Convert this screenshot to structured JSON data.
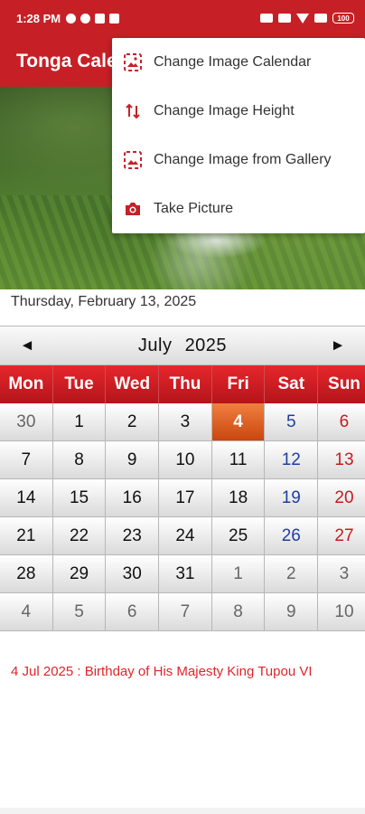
{
  "status_bar": {
    "time": "1:28 PM",
    "battery": "100"
  },
  "app_bar": {
    "title": "Tonga Calendar"
  },
  "menu": {
    "items": [
      {
        "label": "Change Image Calendar",
        "icon": "image-calendar-icon"
      },
      {
        "label": "Change Image Height",
        "icon": "swap-vertical-icon"
      },
      {
        "label": "Change Image from Gallery",
        "icon": "gallery-image-icon"
      },
      {
        "label": "Take Picture",
        "icon": "camera-icon"
      }
    ]
  },
  "today_text": "Thursday, February 13, 2025",
  "calendar": {
    "prev": "◄",
    "next": "►",
    "month": "July",
    "year": "2025",
    "weekdays": [
      "Mon",
      "Tue",
      "Wed",
      "Thu",
      "Fri",
      "Sat",
      "Sun"
    ],
    "weeks": [
      [
        "30",
        "1",
        "2",
        "3",
        "4",
        "5",
        "6"
      ],
      [
        "7",
        "8",
        "9",
        "10",
        "11",
        "12",
        "13"
      ],
      [
        "14",
        "15",
        "16",
        "17",
        "18",
        "19",
        "20"
      ],
      [
        "21",
        "22",
        "23",
        "24",
        "25",
        "26",
        "27"
      ],
      [
        "28",
        "29",
        "30",
        "31",
        "1",
        "2",
        "3"
      ],
      [
        "4",
        "5",
        "6",
        "7",
        "8",
        "9",
        "10"
      ]
    ]
  },
  "holiday": "4 Jul 2025 : Birthday of His Majesty King Tupou VI",
  "colors": {
    "primary": "#c62026",
    "today_cell": "#e06a2c",
    "saturday": "#1f3fa0",
    "sunday": "#c61b1f",
    "holiday_text": "#e0242a"
  }
}
